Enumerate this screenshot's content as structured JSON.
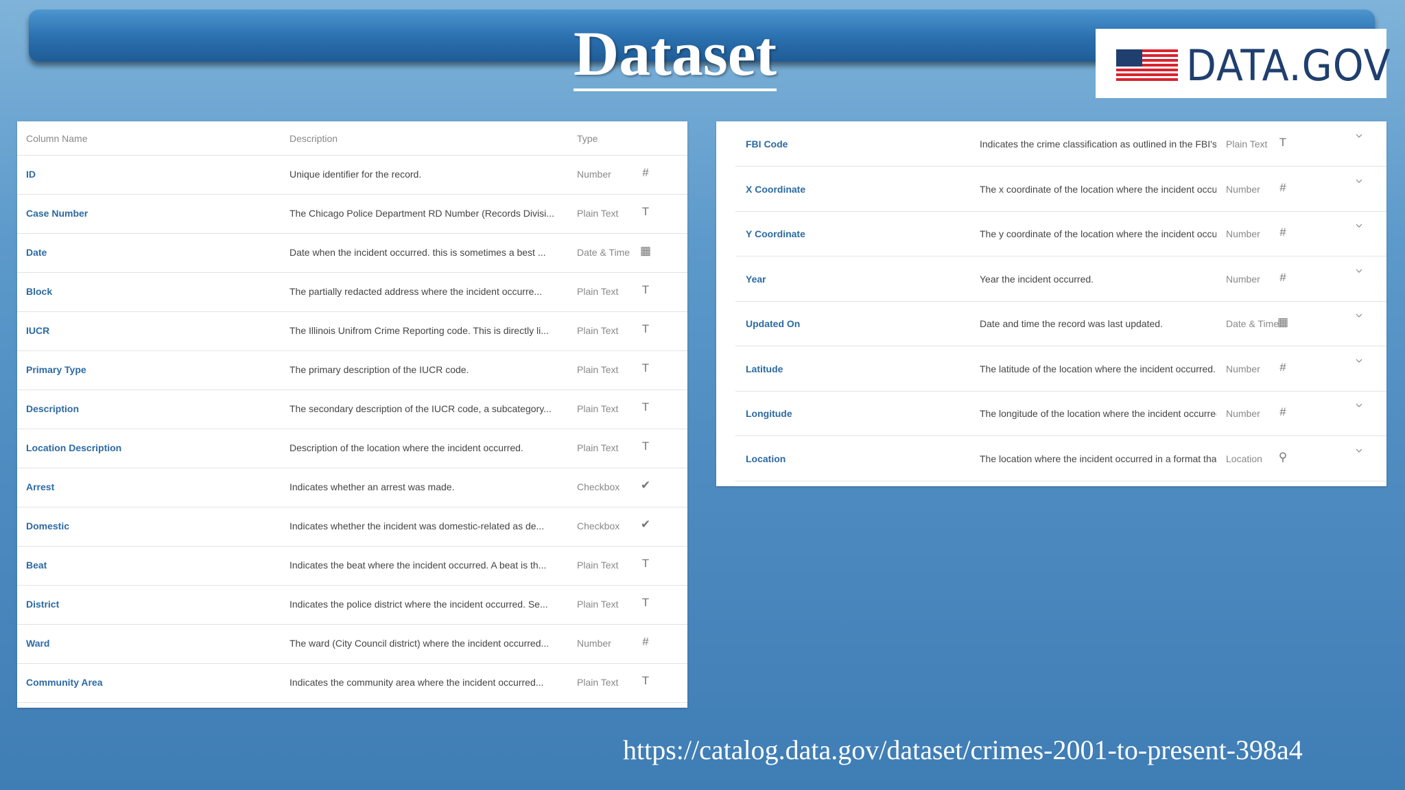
{
  "title": "Dataset",
  "logo": {
    "text": "DATA.GOV",
    "icon": "us-flag-icon"
  },
  "left_table": {
    "headers": {
      "column_name": "Column Name",
      "description": "Description",
      "type": "Type"
    },
    "rows": [
      {
        "name": "ID",
        "description": "Unique identifier for the record.",
        "type": "Number",
        "icon": "#"
      },
      {
        "name": "Case Number",
        "description": "The Chicago Police Department RD Number (Records Divisi...",
        "type": "Plain Text",
        "icon": "T"
      },
      {
        "name": "Date",
        "description": "Date when the incident occurred. this is sometimes a best ...",
        "type": "Date & Time",
        "icon": "▦"
      },
      {
        "name": "Block",
        "description": "The partially redacted address where the incident occurre...",
        "type": "Plain Text",
        "icon": "T"
      },
      {
        "name": "IUCR",
        "description": "The Illinois Unifrom Crime Reporting code. This is directly li...",
        "type": "Plain Text",
        "icon": "T"
      },
      {
        "name": "Primary Type",
        "description": "The primary description of the IUCR code.",
        "type": "Plain Text",
        "icon": "T"
      },
      {
        "name": "Description",
        "description": "The secondary description of the IUCR code, a subcategory...",
        "type": "Plain Text",
        "icon": "T"
      },
      {
        "name": "Location Description",
        "description": "Description of the location where the incident occurred.",
        "type": "Plain Text",
        "icon": "T"
      },
      {
        "name": "Arrest",
        "description": "Indicates whether an arrest was made.",
        "type": "Checkbox",
        "icon": "✔"
      },
      {
        "name": "Domestic",
        "description": "Indicates whether the incident was domestic-related as de...",
        "type": "Checkbox",
        "icon": "✔"
      },
      {
        "name": "Beat",
        "description": "Indicates the beat where the incident occurred. A beat is th...",
        "type": "Plain Text",
        "icon": "T"
      },
      {
        "name": "District",
        "description": "Indicates the police district where the incident occurred. Se...",
        "type": "Plain Text",
        "icon": "T"
      },
      {
        "name": "Ward",
        "description": "The ward (City Council district) where the incident occurred...",
        "type": "Number",
        "icon": "#"
      },
      {
        "name": "Community Area",
        "description": "Indicates the community area where the incident occurred...",
        "type": "Plain Text",
        "icon": "T"
      }
    ]
  },
  "right_table": {
    "rows": [
      {
        "name": "FBI Code",
        "description": "Indicates the crime classification as outlined in the FBI's Na...",
        "type": "Plain Text",
        "icon": "T"
      },
      {
        "name": "X Coordinate",
        "description": "The x coordinate of the location where the incident occurr...",
        "type": "Number",
        "icon": "#"
      },
      {
        "name": "Y Coordinate",
        "description": "The y coordinate of the location where the incident occurr...",
        "type": "Number",
        "icon": "#"
      },
      {
        "name": "Year",
        "description": "Year the incident occurred.",
        "type": "Number",
        "icon": "#"
      },
      {
        "name": "Updated On",
        "description": "Date and time the record was last updated.",
        "type": "Date & Time",
        "icon": "▦"
      },
      {
        "name": "Latitude",
        "description": "The latitude of the location where the incident occurred. T...",
        "type": "Number",
        "icon": "#"
      },
      {
        "name": "Longitude",
        "description": "The longitude of the location where the incident occurred. ...",
        "type": "Number",
        "icon": "#"
      },
      {
        "name": "Location",
        "description": "The location where the incident occurred in a format that a...",
        "type": "Location",
        "icon": "⚲"
      }
    ]
  },
  "url": "https://catalog.data.gov/dataset/crimes-2001-to-present-398a4"
}
